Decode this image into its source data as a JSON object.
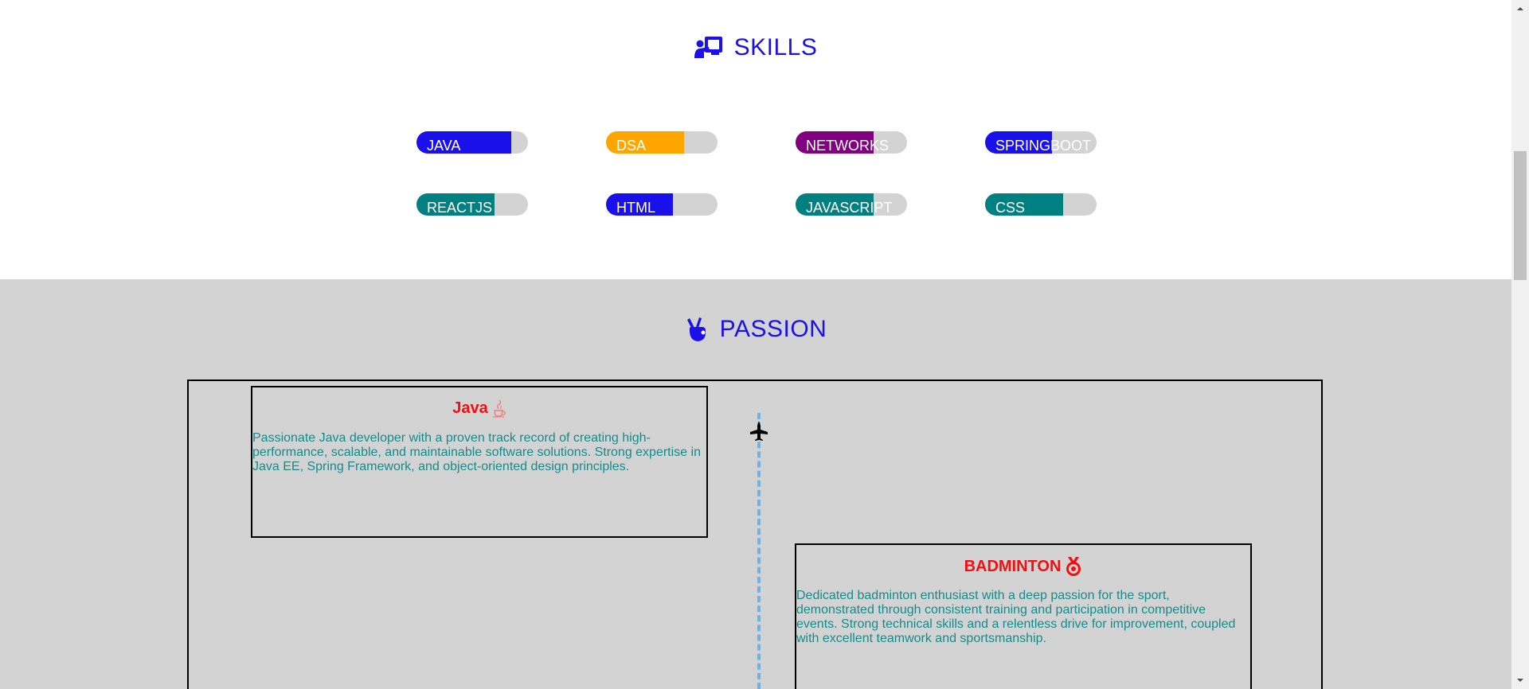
{
  "skills": {
    "title": "SKILLS",
    "icon": "teacher-board-icon",
    "items": [
      {
        "label": "JAVA",
        "level": 0.85,
        "color": "#1a10ea"
      },
      {
        "label": "DSA",
        "level": 0.7,
        "color": "#ffa500"
      },
      {
        "label": "NETWORKS",
        "level": 0.7,
        "color": "#800080"
      },
      {
        "label": "SPRINGBOOT",
        "level": 0.6,
        "color": "#1a10ea"
      },
      {
        "label": "REACTJS",
        "level": 0.7,
        "color": "#008080"
      },
      {
        "label": "HTML",
        "level": 0.6,
        "color": "#1a10ea"
      },
      {
        "label": "JAVASCRIPT",
        "level": 0.7,
        "color": "#008080"
      },
      {
        "label": "CSS",
        "level": 0.7,
        "color": "#008080"
      }
    ],
    "track_color": "#d3d3d3"
  },
  "passion": {
    "title": "PASSION",
    "icon": "peace-hand-icon",
    "timeline_marker_icon": "airplane-icon",
    "cards": [
      {
        "title": "Java",
        "icon": "java-coffee-icon",
        "text": "Passionate Java developer with a proven track record of creating high-performance, scalable, and maintainable software solutions. Strong expertise in Java EE, Spring Framework, and object-oriented design principles."
      },
      {
        "title": "BADMINTON",
        "icon": "medal-icon",
        "text": "Dedicated badminton enthusiast with a deep passion for the sport, demonstrated through consistent training and participation in competitive events. Strong technical skills and a relentless drive for improvement, coupled with excellent teamwork and sportsmanship."
      }
    ]
  },
  "colors": {
    "heading": "#1a10ea",
    "card_title": "#f30f0f",
    "card_text": "#158c8c",
    "timeline": "#6fb2e6",
    "section_bg": "#d3d3d3"
  }
}
